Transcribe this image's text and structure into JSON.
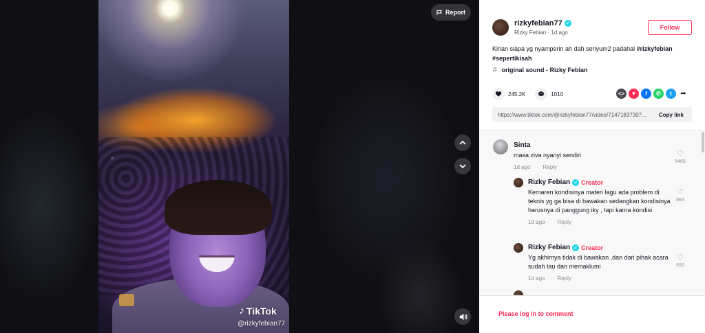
{
  "video": {
    "report_label": "Report",
    "watermark_brand": "TikTok",
    "watermark_handle": "@rizkyfebian77"
  },
  "author": {
    "username": "rizkyfebian77",
    "display_name": "Rizky Febian",
    "separator": "·",
    "posted": "1d ago",
    "follow_label": "Follow",
    "verified": true
  },
  "caption": {
    "text": "Kirian siapa yg nyamperin ah dah senyum2 padahal ",
    "hashtags": [
      "#rizkyfebian",
      "#sepertikisah"
    ]
  },
  "music": {
    "label": "original sound - Rizky Febian",
    "icon": "music-note-icon"
  },
  "stats": {
    "likes": "245.2K",
    "comments": "1010"
  },
  "share": {
    "icons": [
      "embed-icon",
      "send-to-friends-icon",
      "facebook-icon",
      "whatsapp-icon",
      "twitter-icon",
      "share-arrow-icon"
    ],
    "colors": {
      "embed": "#4a4a4f",
      "send": "#fe2c55",
      "facebook": "#0075fa",
      "whatsapp": "#25d366",
      "twitter": "#1da1f2"
    }
  },
  "link": {
    "url": "https://www.tiktok.com/@rizkyfebian77/video/71471837307...",
    "copy_label": "Copy link"
  },
  "comments": [
    {
      "name": "Sinta",
      "text": "masa ziva nyanyi sendiri",
      "time": "1d ago",
      "reply": "Reply",
      "likes": "5465"
    },
    {
      "name": "Rizky Febian",
      "badge": "Creator",
      "text": "Kemaren kondisinya materi lagu ada problem di teknis yg ga bisa di bawakan sedangkan kondisinya harusnya di panggung iky , tapi karna kondisi",
      "time": "1d ago",
      "reply": "Reply",
      "likes": "863"
    },
    {
      "name": "Rizky Febian",
      "badge": "Creator",
      "text": "Yg akhirnya tidak di bawakan ,dan dari pihak acara sudah tau dan memaklumi",
      "time": "1d ago",
      "reply": "Reply",
      "likes": "632"
    }
  ],
  "footer": {
    "login_label": "Please log in to comment"
  },
  "colors": {
    "accent": "#fe2c55",
    "verified": "#20d5ec"
  }
}
